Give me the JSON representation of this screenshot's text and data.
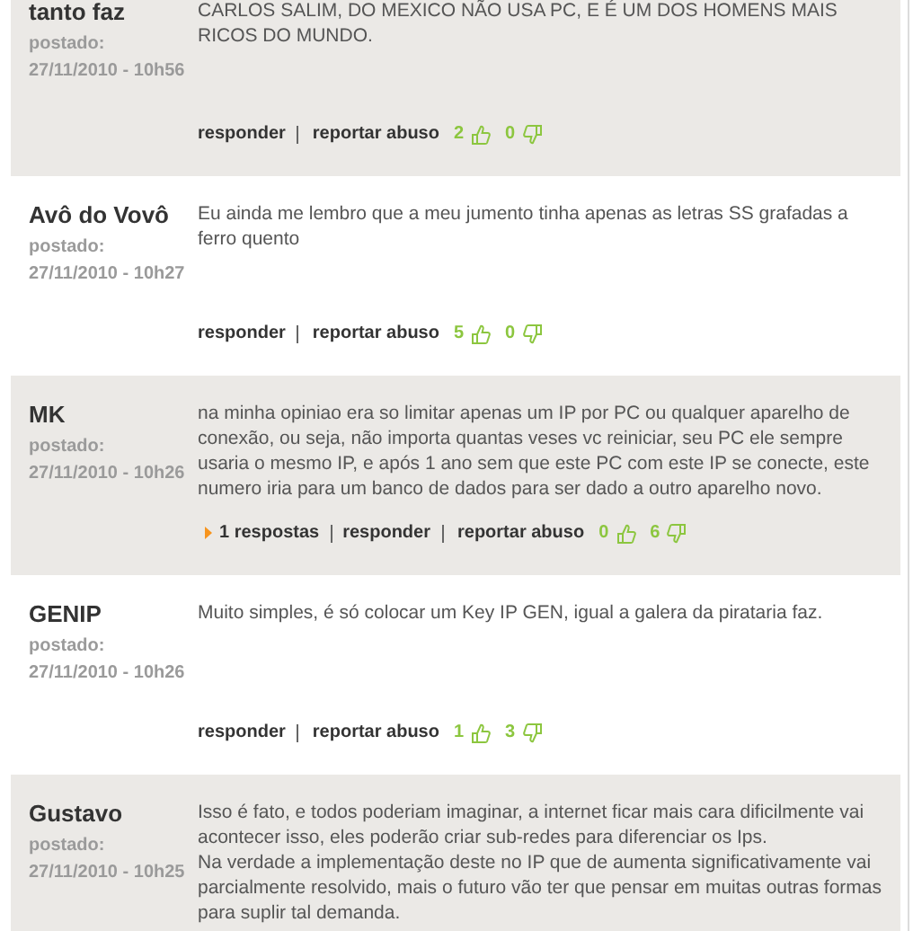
{
  "comments": [
    {
      "author": "tanto faz",
      "posted_label": "postado:",
      "posted_at": "27/11/2010 - 10h56",
      "paragraphs": [
        "CARLOS SALIM, DO MEXICO NÃO USA PC, E É UM DOS HOMENS MAIS RICOS DO MUNDO."
      ],
      "reply": "responder",
      "report": "reportar abuso",
      "likes": "2",
      "dislikes": "0"
    },
    {
      "author": "Avô do Vovô",
      "posted_label": "postado:",
      "posted_at": "27/11/2010 - 10h27",
      "paragraphs": [
        "Eu ainda me lembro que a meu jumento tinha apenas as letras SS grafadas a ferro quento"
      ],
      "reply": "responder",
      "report": "reportar abuso",
      "likes": "5",
      "dislikes": "0"
    },
    {
      "author": "MK",
      "posted_label": "postado:",
      "posted_at": "27/11/2010 - 10h26",
      "paragraphs": [
        "na minha opiniao era so limitar apenas um IP por PC ou qualquer aparelho de conexão, ou seja, não importa quantas veses vc reiniciar, seu PC ele sempre usaria o mesmo IP, e após 1 ano sem que este PC com este IP se conecte, este numero iria para um banco de dados para ser dado a outro aparelho novo."
      ],
      "replies": "1 respostas",
      "reply": "responder",
      "report": "reportar abuso",
      "likes": "0",
      "dislikes": "6"
    },
    {
      "author": "GENIP",
      "posted_label": "postado:",
      "posted_at": "27/11/2010 - 10h26",
      "paragraphs": [
        "Muito simples, é só colocar um Key IP GEN, igual a galera da pirataria faz."
      ],
      "reply": "responder",
      "report": "reportar abuso",
      "likes": "1",
      "dislikes": "3"
    },
    {
      "author": "Gustavo",
      "posted_label": "postado:",
      "posted_at": "27/11/2010 - 10h25",
      "paragraphs": [
        "Isso é fato, e todos poderiam imaginar, a internet ficar mais cara dificilmente vai acontecer isso, eles poderão criar sub-redes para diferenciar os Ips.",
        "Na verdade a implementação deste no IP que de aumenta significativamente vai parcialmente resolvido, mais o futuro vão ter que pensar em muitas outras formas para suplir tal demanda."
      ]
    }
  ]
}
